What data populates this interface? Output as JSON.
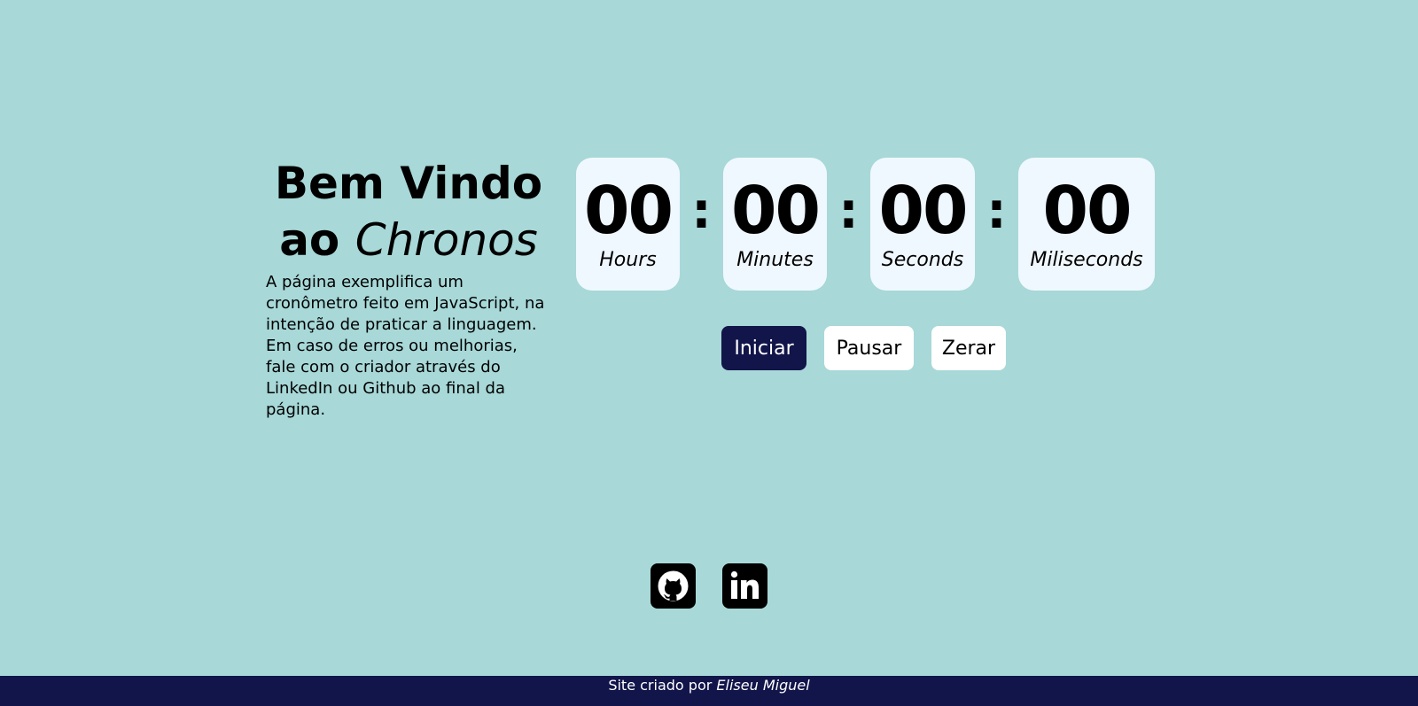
{
  "intro": {
    "title_line1": "Bem Vindo",
    "title_ao": "ao",
    "title_brand": "Chronos",
    "description": "A página exemplifica um cronômetro feito em JavaScript, na intenção de praticar a linguagem. Em caso de erros ou melhorias, fale com o criador através do LinkedIn ou Github ao final da página."
  },
  "timer": {
    "hours": "00",
    "minutes": "00",
    "seconds": "00",
    "milliseconds": "00",
    "separator": ":",
    "labels": {
      "hours": "Hours",
      "minutes": "Minutes",
      "seconds": "Seconds",
      "milliseconds": "Miliseconds"
    }
  },
  "buttons": {
    "start": "Iniciar",
    "pause": "Pausar",
    "reset": "Zerar"
  },
  "social": {
    "github_icon": "github-icon",
    "linkedin_icon": "linkedin-icon"
  },
  "footer": {
    "prefix": "Site criado por",
    "author": "Eliseu Miguel"
  },
  "colors": {
    "background": "#a8d8d8",
    "card": "#f0f8ff",
    "primary": "#12154a",
    "footer": "#12154a"
  }
}
